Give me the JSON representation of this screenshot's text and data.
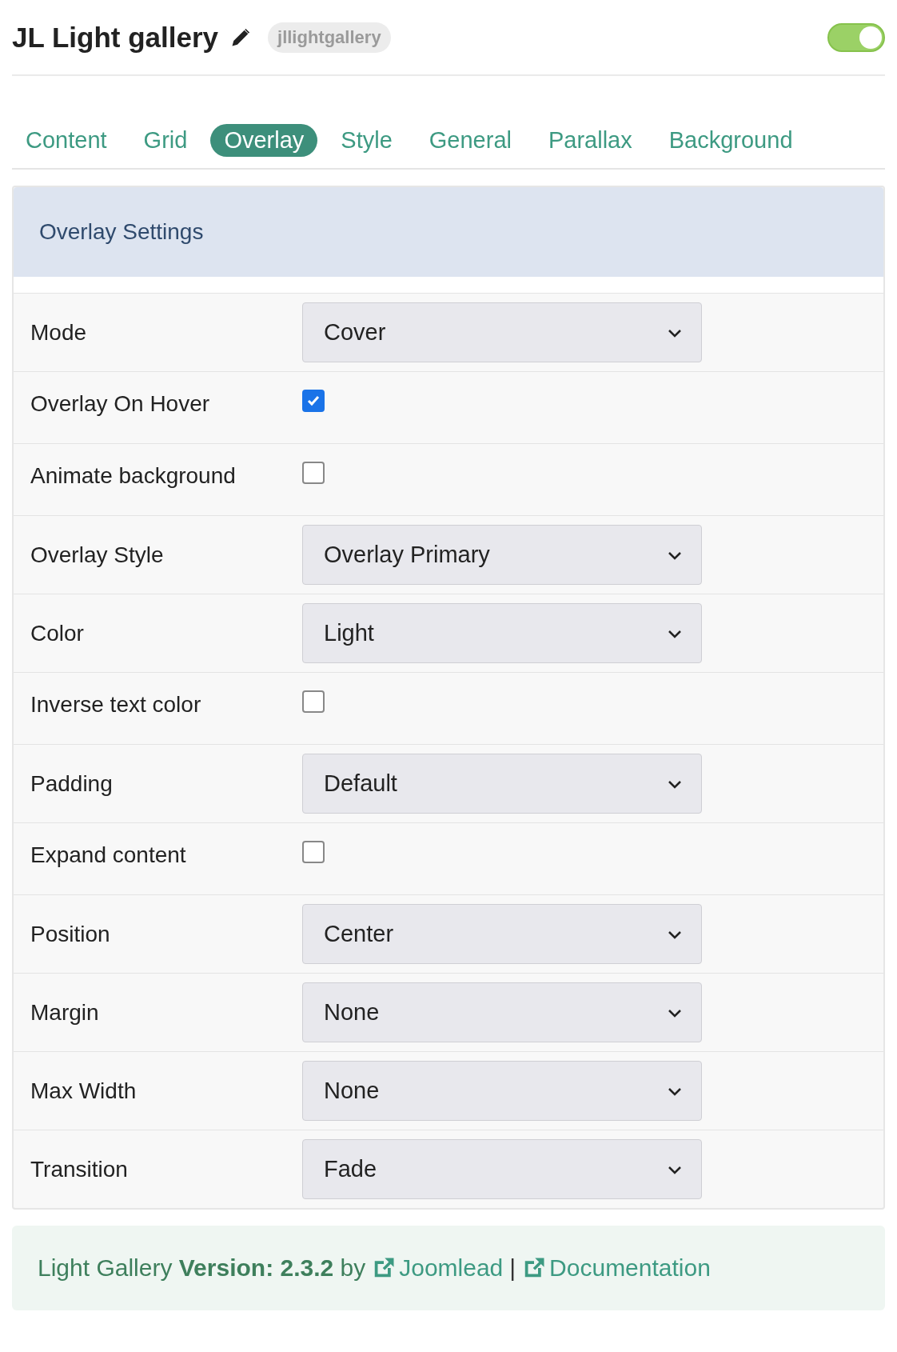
{
  "header": {
    "title": "JL Light gallery",
    "alias": "jllightgallery",
    "enabled": true
  },
  "tabs": [
    {
      "label": "Content",
      "selected": false
    },
    {
      "label": "Grid",
      "selected": false
    },
    {
      "label": "Overlay",
      "selected": true
    },
    {
      "label": "Style",
      "selected": false
    },
    {
      "label": "General",
      "selected": false
    },
    {
      "label": "Parallax",
      "selected": false
    },
    {
      "label": "Background",
      "selected": false
    }
  ],
  "panel": {
    "title": "Overlay Settings",
    "fields": [
      {
        "kind": "select",
        "label": "Mode",
        "value": "Cover"
      },
      {
        "kind": "checkbox",
        "label": "Overlay On Hover",
        "checked": true
      },
      {
        "kind": "checkbox",
        "label": "Animate background",
        "checked": false
      },
      {
        "kind": "select",
        "label": "Overlay Style",
        "value": "Overlay Primary"
      },
      {
        "kind": "select",
        "label": "Color",
        "value": "Light"
      },
      {
        "kind": "checkbox",
        "label": "Inverse text color",
        "checked": false
      },
      {
        "kind": "select",
        "label": "Padding",
        "value": "Default"
      },
      {
        "kind": "checkbox",
        "label": "Expand content",
        "checked": false
      },
      {
        "kind": "select",
        "label": "Position",
        "value": "Center"
      },
      {
        "kind": "select",
        "label": "Margin",
        "value": "None"
      },
      {
        "kind": "select",
        "label": "Max Width",
        "value": "None"
      },
      {
        "kind": "select",
        "label": "Transition",
        "value": "Fade"
      }
    ]
  },
  "footer": {
    "text": "Light Gallery **Version: 2.3.2** by",
    "links": [
      {
        "label": "Joomlead"
      },
      {
        "label": "Documentation"
      }
    ],
    "separator": "|"
  }
}
